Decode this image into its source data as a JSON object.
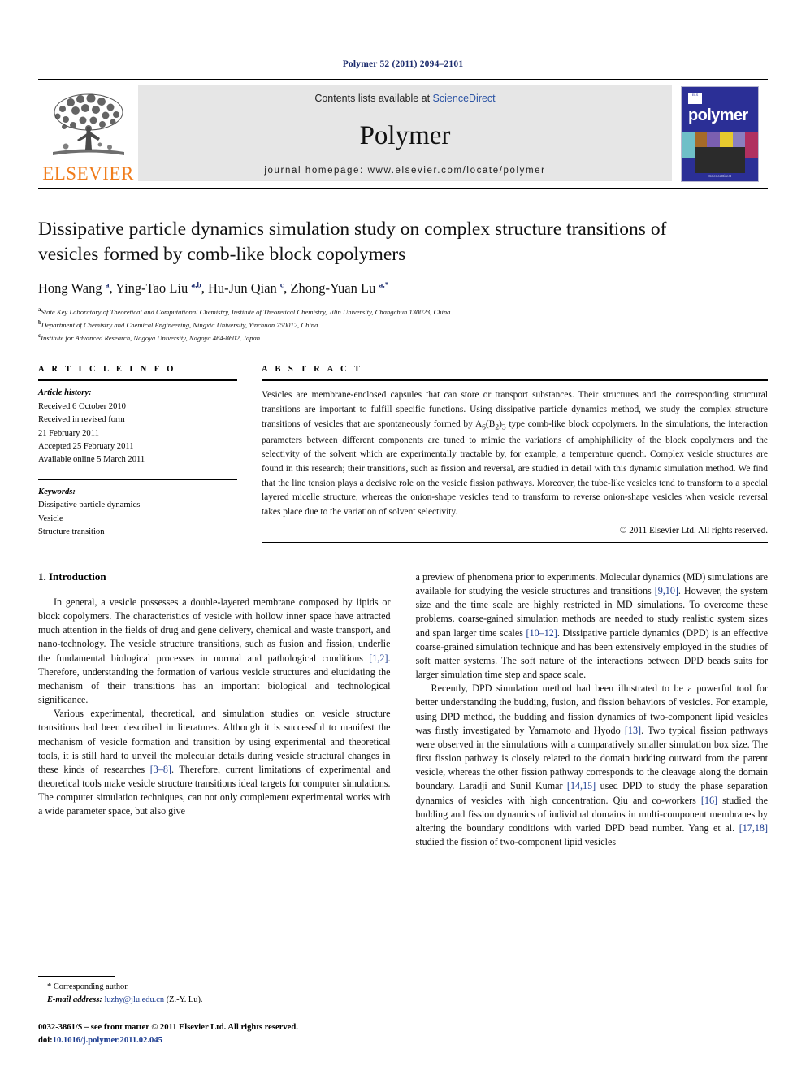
{
  "running_head": "Polymer 52 (2011) 2094–2101",
  "masthead": {
    "publisher": "ELSEVIER",
    "contents_prefix": "Contents lists available at ",
    "contents_link": "ScienceDirect",
    "journal_name": "Polymer",
    "homepage": "journal homepage: www.elsevier.com/locate/polymer",
    "cover_title": "polymer",
    "cover_logo_text": "ELS",
    "cover_footer": "ScienceDirect"
  },
  "article": {
    "title": "Dissipative particle dynamics simulation study on complex structure transitions of vesicles formed by comb-like block copolymers",
    "authors_html": "Hong Wang <sup>a</sup>, Ying-Tao Liu <sup>a,b</sup>, Hu-Jun Qian <sup>c</sup>, Zhong-Yuan Lu <sup>a,*</sup>",
    "affiliations": [
      "State Key Laboratory of Theoretical and Computational Chemistry, Institute of Theoretical Chemistry, Jilin University, Changchun 130023, China",
      "Department of Chemistry and Chemical Engineering, Ningxia University, Yinchuan 750012, China",
      "Institute for Advanced Research, Nagoya University, Nagoya 464-8602, Japan"
    ],
    "affil_marks": [
      "a",
      "b",
      "c"
    ]
  },
  "article_info": {
    "heading": "A R T I C L E  I N F O",
    "history_label": "Article history:",
    "history": [
      "Received 6 October 2010",
      "Received in revised form",
      "21 February 2011",
      "Accepted 25 February 2011",
      "Available online 5 March 2011"
    ],
    "keywords_label": "Keywords:",
    "keywords": [
      "Dissipative particle dynamics",
      "Vesicle",
      "Structure transition"
    ]
  },
  "abstract": {
    "heading": "A B S T R A C T",
    "text_html": "Vesicles are membrane-enclosed capsules that can store or transport substances. Their structures and the corresponding structural transitions are important to fulfill specific functions. Using dissipative particle dynamics method, we study the complex structure transitions of vesicles that are spontaneously formed by A<sub>6</sub>(B<sub>2</sub>)<sub>3</sub> type comb-like block copolymers. In the simulations, the interaction parameters between different components are tuned to mimic the variations of amphiphilicity of the block copolymers and the selectivity of the solvent which are experimentally tractable by, for example, a temperature quench. Complex vesicle structures are found in this research; their transitions, such as fission and reversal, are studied in detail with this dynamic simulation method. We find that the line tension plays a decisive role on the vesicle fission pathways. Moreover, the tube-like vesicles tend to transform to a special layered micelle structure, whereas the onion-shape vesicles tend to transform to reverse onion-shape vesicles when vesicle reversal takes place due to the variation of solvent selectivity.",
    "copyright": "© 2011 Elsevier Ltd. All rights reserved."
  },
  "body": {
    "section_number_title": "1.  Introduction",
    "left_paragraphs_html": [
      "In general, a vesicle possesses a double-layered membrane composed by lipids or block copolymers. The characteristics of vesicle with hollow inner space have attracted much attention in the fields of drug and gene delivery, chemical and waste transport, and nano-technology. The vesicle structure transitions, such as fusion and fission, underlie the fundamental biological processes in normal and pathological conditions <span class=\"ref\">[1,2]</span>. Therefore, understanding the formation of various vesicle structures and elucidating the mechanism of their transitions has an important biological and technological significance.",
      "Various experimental, theoretical, and simulation studies on vesicle structure transitions had been described in literatures. Although it is successful to manifest the mechanism of vesicle formation and transition by using experimental and theoretical tools, it is still hard to unveil the molecular details during vesicle structural changes in these kinds of researches <span class=\"ref\">[3–8]</span>. Therefore, current limitations of experimental and theoretical tools make vesicle structure transitions ideal targets for computer simulations. The computer simulation techniques, can not only complement experimental works with a wide parameter space, but also give"
    ],
    "right_paragraphs_html": [
      "a preview of phenomena prior to experiments. Molecular dynamics (MD) simulations are available for studying the vesicle structures and transitions <span class=\"ref\">[9,10]</span>. However, the system size and the time scale are highly restricted in MD simulations. To overcome these problems, coarse-gained simulation methods are needed to study realistic system sizes and span larger time scales <span class=\"ref\">[10–12]</span>. Dissipative particle dynamics (DPD) is an effective coarse-grained simulation technique and has been extensively employed in the studies of soft matter systems. The soft nature of the interactions between DPD beads suits for larger simulation time step and space scale.",
      "Recently, DPD simulation method had been illustrated to be a powerful tool for better understanding the budding, fusion, and fission behaviors of vesicles. For example, using DPD method, the budding and fission dynamics of two-component lipid vesicles was firstly investigated by Yamamoto and Hyodo <span class=\"ref\">[13]</span>. Two typical fission pathways were observed in the simulations with a comparatively smaller simulation box size. The first fission pathway is closely related to the domain budding outward from the parent vesicle, whereas the other fission pathway corresponds to the cleavage along the domain boundary. Laradji and Sunil Kumar <span class=\"ref\">[14,15]</span> used DPD to study the phase separation dynamics of vesicles with high concentration. Qiu and co-workers <span class=\"ref\">[16]</span> studied the budding and fission dynamics of individual domains in multi-component membranes by altering the boundary conditions with varied DPD bead number. Yang et al. <span class=\"ref\">[17,18]</span> studied the fission of two-component lipid vesicles"
    ]
  },
  "footer": {
    "corresponding_marker": "*",
    "corresponding_label": "Corresponding author.",
    "email_label": "E-mail address:",
    "email": "luzhy@jlu.edu.cn",
    "email_suffix": "(Z.-Y. Lu).",
    "issn_line": "0032-3861/$ – see front matter © 2011 Elsevier Ltd. All rights reserved.",
    "doi_prefix": "doi:",
    "doi": "10.1016/j.polymer.2011.02.045"
  },
  "colors": {
    "elsevier_orange": "#f07c1b",
    "link_blue": "#1a3a8f",
    "sciencedirect_blue": "#2b53a4",
    "cover_blue": "#2b2f96",
    "masthead_grey": "#e6e6e6"
  }
}
